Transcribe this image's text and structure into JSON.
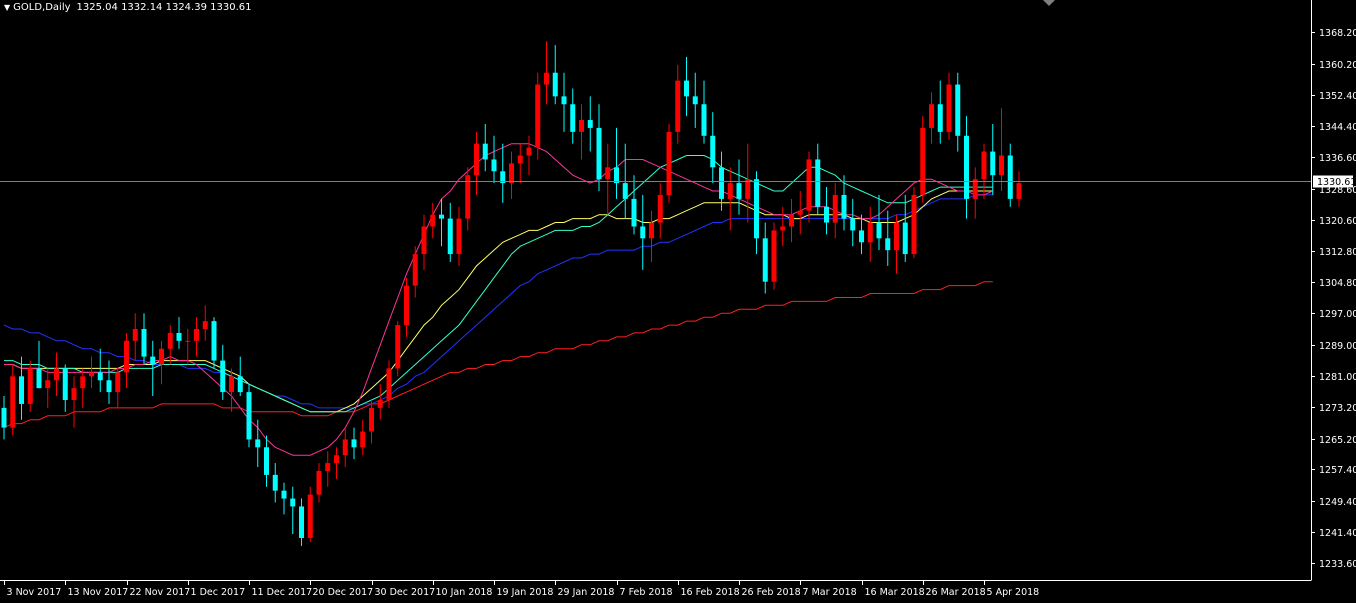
{
  "header": {
    "symbol": "GOLD,Daily",
    "ohlc": "1325.04 1332.14 1324.39 1330.61"
  },
  "colors": {
    "background": "#000000",
    "axis": "#ffffff",
    "bull_candle": "#ff0000",
    "bear_candle": "#00ffff",
    "ma_fast_magenta": "#ff3399",
    "ma_cyan": "#33ffcc",
    "ma_yellow": "#ffff66",
    "ma_blue": "#2233ff",
    "ma_long_red": "#ff2020",
    "price_line": "#4f7fff"
  },
  "chart_data": {
    "type": "candlestick",
    "ylim": [
      1229.6,
      1372.0
    ],
    "price_ticks": [
      1368.2,
      1360.2,
      1352.4,
      1344.4,
      1336.6,
      1328.6,
      1320.6,
      1312.8,
      1304.8,
      1297.0,
      1289.0,
      1281.0,
      1273.2,
      1265.2,
      1257.4,
      1249.4,
      1241.4,
      1233.6
    ],
    "date_labels": [
      "3 Nov 2017",
      "13 Nov 2017",
      "22 Nov 2017",
      "1 Dec 2017",
      "11 Dec 2017",
      "20 Dec 2017",
      "30 Dec 2017",
      "10 Jan 2018",
      "19 Jan 2018",
      "29 Jan 2018",
      "7 Feb 2018",
      "16 Feb 2018",
      "26 Feb 2018",
      "7 Mar 2018",
      "16 Mar 2018",
      "26 Mar 2018",
      "5 Apr 2018"
    ],
    "date_label_index": [
      0,
      7,
      14,
      21,
      28,
      35,
      42,
      49,
      56,
      63,
      70,
      77,
      84,
      91,
      98,
      105,
      112
    ],
    "current_price": 1330.61,
    "current_price_label": "1330.61",
    "candles": [
      [
        1273,
        1276,
        1265,
        1268
      ],
      [
        1268,
        1284,
        1266,
        1281
      ],
      [
        1281,
        1286,
        1270,
        1274
      ],
      [
        1274,
        1285,
        1272,
        1283
      ],
      [
        1283,
        1290,
        1278,
        1278
      ],
      [
        1278,
        1283,
        1273,
        1280
      ],
      [
        1280,
        1287,
        1276,
        1283
      ],
      [
        1283,
        1284,
        1272,
        1275
      ],
      [
        1275,
        1281,
        1268,
        1278
      ],
      [
        1278,
        1283,
        1273,
        1281
      ],
      [
        1281,
        1286,
        1278,
        1282
      ],
      [
        1282,
        1288,
        1277,
        1280
      ],
      [
        1280,
        1285,
        1274,
        1277
      ],
      [
        1277,
        1283,
        1273,
        1282
      ],
      [
        1282,
        1292,
        1278,
        1290
      ],
      [
        1290,
        1297,
        1285,
        1293
      ],
      [
        1293,
        1297,
        1284,
        1286
      ],
      [
        1286,
        1290,
        1276,
        1284
      ],
      [
        1284,
        1290,
        1279,
        1288
      ],
      [
        1288,
        1294,
        1284,
        1292
      ],
      [
        1292,
        1296,
        1288,
        1290
      ],
      [
        1290,
        1293,
        1284,
        1290
      ],
      [
        1290,
        1296,
        1286,
        1293
      ],
      [
        1293,
        1299,
        1290,
        1295
      ],
      [
        1295,
        1296,
        1283,
        1285
      ],
      [
        1285,
        1289,
        1275,
        1277
      ],
      [
        1277,
        1283,
        1272,
        1281
      ],
      [
        1281,
        1286,
        1276,
        1277
      ],
      [
        1277,
        1279,
        1263,
        1265
      ],
      [
        1265,
        1270,
        1258,
        1263
      ],
      [
        1263,
        1266,
        1253,
        1256
      ],
      [
        1256,
        1259,
        1249,
        1252
      ],
      [
        1252,
        1254,
        1246,
        1250
      ],
      [
        1250,
        1253,
        1241,
        1248
      ],
      [
        1248,
        1250,
        1238,
        1240
      ],
      [
        1240,
        1253,
        1239,
        1251
      ],
      [
        1251,
        1259,
        1249,
        1257
      ],
      [
        1257,
        1262,
        1253,
        1259
      ],
      [
        1259,
        1263,
        1255,
        1261
      ],
      [
        1261,
        1268,
        1258,
        1265
      ],
      [
        1265,
        1268,
        1260,
        1263
      ],
      [
        1263,
        1270,
        1261,
        1267
      ],
      [
        1267,
        1275,
        1264,
        1273
      ],
      [
        1273,
        1279,
        1270,
        1275
      ],
      [
        1275,
        1285,
        1273,
        1283
      ],
      [
        1283,
        1295,
        1281,
        1294
      ],
      [
        1294,
        1306,
        1291,
        1304
      ],
      [
        1304,
        1314,
        1301,
        1312
      ],
      [
        1312,
        1322,
        1308,
        1319
      ],
      [
        1319,
        1325,
        1316,
        1322
      ],
      [
        1322,
        1326,
        1314,
        1321
      ],
      [
        1321,
        1325,
        1310,
        1312
      ],
      [
        1312,
        1324,
        1309,
        1321
      ],
      [
        1321,
        1334,
        1318,
        1332
      ],
      [
        1332,
        1343,
        1327,
        1340
      ],
      [
        1340,
        1345,
        1333,
        1336
      ],
      [
        1336,
        1342,
        1330,
        1333
      ],
      [
        1333,
        1340,
        1325,
        1330
      ],
      [
        1330,
        1338,
        1326,
        1335
      ],
      [
        1335,
        1340,
        1330,
        1337
      ],
      [
        1337,
        1342,
        1332,
        1339
      ],
      [
        1339,
        1358,
        1336,
        1355
      ],
      [
        1355,
        1366,
        1350,
        1358
      ],
      [
        1358,
        1365,
        1350,
        1352
      ],
      [
        1352,
        1358,
        1343,
        1350
      ],
      [
        1350,
        1354,
        1340,
        1343
      ],
      [
        1343,
        1350,
        1336,
        1346
      ],
      [
        1346,
        1352,
        1338,
        1344
      ],
      [
        1344,
        1350,
        1328,
        1331
      ],
      [
        1331,
        1340,
        1322,
        1334
      ],
      [
        1334,
        1344,
        1326,
        1330
      ],
      [
        1330,
        1340,
        1321,
        1326
      ],
      [
        1326,
        1332,
        1317,
        1319
      ],
      [
        1319,
        1327,
        1308,
        1316
      ],
      [
        1316,
        1323,
        1310,
        1320
      ],
      [
        1320,
        1330,
        1316,
        1327
      ],
      [
        1327,
        1345,
        1325,
        1343
      ],
      [
        1343,
        1360,
        1340,
        1356
      ],
      [
        1356,
        1362,
        1347,
        1352
      ],
      [
        1352,
        1358,
        1344,
        1350
      ],
      [
        1350,
        1356,
        1340,
        1342
      ],
      [
        1342,
        1348,
        1330,
        1334
      ],
      [
        1334,
        1338,
        1323,
        1326
      ],
      [
        1326,
        1334,
        1318,
        1330
      ],
      [
        1330,
        1336,
        1322,
        1326
      ],
      [
        1326,
        1340,
        1320,
        1331
      ],
      [
        1331,
        1333,
        1312,
        1316
      ],
      [
        1316,
        1320,
        1302,
        1305
      ],
      [
        1305,
        1320,
        1303,
        1318
      ],
      [
        1318,
        1324,
        1314,
        1319
      ],
      [
        1319,
        1326,
        1315,
        1322
      ],
      [
        1322,
        1328,
        1317,
        1323
      ],
      [
        1323,
        1338,
        1320,
        1336
      ],
      [
        1336,
        1340,
        1322,
        1324
      ],
      [
        1324,
        1329,
        1317,
        1320
      ],
      [
        1320,
        1330,
        1316,
        1327
      ],
      [
        1327,
        1332,
        1318,
        1321
      ],
      [
        1321,
        1326,
        1314,
        1318
      ],
      [
        1318,
        1322,
        1312,
        1315
      ],
      [
        1315,
        1324,
        1310,
        1320
      ],
      [
        1320,
        1327,
        1313,
        1316
      ],
      [
        1316,
        1323,
        1309,
        1313
      ],
      [
        1313,
        1322,
        1307,
        1320
      ],
      [
        1320,
        1327,
        1310,
        1312
      ],
      [
        1312,
        1329,
        1311,
        1327
      ],
      [
        1327,
        1347,
        1325,
        1344
      ],
      [
        1344,
        1353,
        1340,
        1350
      ],
      [
        1350,
        1356,
        1340,
        1343
      ],
      [
        1343,
        1358,
        1341,
        1355
      ],
      [
        1355,
        1358,
        1338,
        1342
      ],
      [
        1342,
        1347,
        1321,
        1326
      ],
      [
        1326,
        1334,
        1321,
        1331
      ],
      [
        1331,
        1340,
        1326,
        1338
      ],
      [
        1338,
        1345,
        1327,
        1332
      ],
      [
        1332,
        1349,
        1328,
        1337
      ],
      [
        1337,
        1340,
        1324,
        1326
      ],
      [
        1326,
        1333,
        1324,
        1330
      ]
    ],
    "moving_averages": [
      {
        "role": "ma_long_red",
        "values": [
          1268,
          1269,
          1269,
          1270,
          1270,
          1271,
          1271,
          1271,
          1272,
          1272,
          1272,
          1272,
          1273,
          1273,
          1273,
          1273,
          1273,
          1273,
          1274,
          1274,
          1274,
          1274,
          1274,
          1274,
          1274,
          1273,
          1273,
          1273,
          1272,
          1272,
          1272,
          1272,
          1272,
          1272,
          1271,
          1271,
          1271,
          1271,
          1272,
          1272,
          1272,
          1273,
          1274,
          1274,
          1275,
          1276,
          1277,
          1278,
          1279,
          1280,
          1281,
          1282,
          1282,
          1283,
          1283,
          1284,
          1284,
          1285,
          1285,
          1286,
          1286,
          1287,
          1287,
          1288,
          1288,
          1288,
          1289,
          1289,
          1290,
          1290,
          1291,
          1291,
          1292,
          1292,
          1293,
          1293,
          1294,
          1294,
          1295,
          1295,
          1296,
          1296,
          1297,
          1297,
          1298,
          1298,
          1298,
          1299,
          1299,
          1299,
          1300,
          1300,
          1300,
          1300,
          1300,
          1301,
          1301,
          1301,
          1301,
          1302,
          1302,
          1302,
          1302,
          1302,
          1302,
          1303,
          1303,
          1303,
          1304,
          1304,
          1304,
          1304,
          1305,
          1305
        ]
      },
      {
        "role": "ma_blue",
        "values": [
          1294,
          1293,
          1293,
          1292,
          1292,
          1291,
          1290,
          1290,
          1289,
          1288,
          1288,
          1287,
          1287,
          1286,
          1286,
          1285,
          1285,
          1284,
          1284,
          1284,
          1284,
          1283,
          1283,
          1283,
          1282,
          1282,
          1281,
          1280,
          1279,
          1278,
          1277,
          1276,
          1276,
          1275,
          1274,
          1274,
          1273,
          1273,
          1273,
          1273,
          1273,
          1274,
          1274,
          1275,
          1276,
          1278,
          1279,
          1281,
          1282,
          1284,
          1286,
          1288,
          1290,
          1292,
          1294,
          1296,
          1298,
          1300,
          1302,
          1304,
          1305,
          1307,
          1308,
          1309,
          1310,
          1311,
          1311,
          1312,
          1312,
          1313,
          1313,
          1313,
          1313,
          1314,
          1314,
          1315,
          1315,
          1316,
          1317,
          1318,
          1319,
          1320,
          1320,
          1321,
          1321,
          1321,
          1321,
          1321,
          1321,
          1321,
          1321,
          1321,
          1321,
          1321,
          1321,
          1321,
          1321,
          1321,
          1321,
          1321,
          1321,
          1321,
          1322,
          1322,
          1323,
          1324,
          1325,
          1326,
          1326,
          1326,
          1326,
          1327,
          1327,
          1327
        ]
      },
      {
        "role": "ma_yellow",
        "values": [
          1284,
          1284,
          1283,
          1283,
          1283,
          1283,
          1283,
          1283,
          1283,
          1283,
          1283,
          1283,
          1283,
          1283,
          1284,
          1284,
          1284,
          1284,
          1285,
          1285,
          1285,
          1285,
          1285,
          1285,
          1284,
          1283,
          1282,
          1281,
          1279,
          1278,
          1277,
          1276,
          1275,
          1274,
          1273,
          1272,
          1272,
          1272,
          1272,
          1273,
          1274,
          1276,
          1278,
          1280,
          1282,
          1285,
          1288,
          1291,
          1294,
          1296,
          1299,
          1301,
          1303,
          1306,
          1309,
          1311,
          1313,
          1315,
          1316,
          1317,
          1318,
          1318,
          1319,
          1320,
          1320,
          1321,
          1321,
          1321,
          1322,
          1322,
          1321,
          1321,
          1321,
          1320,
          1320,
          1321,
          1321,
          1322,
          1323,
          1324,
          1325,
          1325,
          1325,
          1325,
          1325,
          1324,
          1323,
          1322,
          1322,
          1322,
          1321,
          1321,
          1322,
          1322,
          1322,
          1322,
          1322,
          1321,
          1321,
          1320,
          1320,
          1320,
          1320,
          1321,
          1322,
          1324,
          1326,
          1327,
          1328,
          1328,
          1328,
          1328,
          1328,
          1328
        ]
      },
      {
        "role": "ma_cyan",
        "values": [
          1285,
          1285,
          1284,
          1284,
          1284,
          1283,
          1283,
          1283,
          1283,
          1282,
          1282,
          1282,
          1282,
          1282,
          1283,
          1283,
          1283,
          1283,
          1284,
          1284,
          1284,
          1284,
          1284,
          1284,
          1283,
          1282,
          1281,
          1280,
          1279,
          1278,
          1277,
          1276,
          1275,
          1274,
          1273,
          1272,
          1272,
          1272,
          1272,
          1272,
          1273,
          1274,
          1275,
          1276,
          1278,
          1280,
          1282,
          1284,
          1286,
          1288,
          1290,
          1292,
          1294,
          1297,
          1300,
          1303,
          1306,
          1309,
          1312,
          1314,
          1315,
          1316,
          1317,
          1318,
          1318,
          1318,
          1319,
          1319,
          1320,
          1322,
          1324,
          1326,
          1328,
          1330,
          1332,
          1334,
          1335,
          1336,
          1337,
          1337,
          1337,
          1336,
          1334,
          1333,
          1332,
          1331,
          1330,
          1329,
          1328,
          1328,
          1330,
          1332,
          1334,
          1334,
          1333,
          1332,
          1330,
          1329,
          1328,
          1327,
          1326,
          1325,
          1325,
          1325,
          1326,
          1327,
          1328,
          1329,
          1329,
          1329,
          1329,
          1329,
          1329,
          1329
        ]
      },
      {
        "role": "ma_fast_magenta",
        "values": [
          1284,
          1284,
          1283,
          1283,
          1283,
          1282,
          1282,
          1282,
          1282,
          1282,
          1282,
          1282,
          1282,
          1283,
          1283,
          1284,
          1284,
          1285,
          1285,
          1286,
          1285,
          1285,
          1284,
          1282,
          1280,
          1278,
          1276,
          1273,
          1270,
          1268,
          1265,
          1263,
          1262,
          1261,
          1261,
          1261,
          1262,
          1263,
          1265,
          1268,
          1272,
          1277,
          1283,
          1289,
          1295,
          1301,
          1307,
          1312,
          1317,
          1322,
          1326,
          1328,
          1331,
          1333,
          1335,
          1337,
          1338,
          1339,
          1340,
          1340,
          1340,
          1339,
          1338,
          1336,
          1334,
          1332,
          1331,
          1330,
          1331,
          1333,
          1334,
          1336,
          1336,
          1336,
          1335,
          1334,
          1333,
          1332,
          1331,
          1330,
          1329,
          1328,
          1328,
          1327,
          1326,
          1325,
          1324,
          1323,
          1322,
          1322,
          1322,
          1323,
          1324,
          1324,
          1324,
          1323,
          1322,
          1322,
          1321,
          1321,
          1322,
          1324,
          1326,
          1328,
          1330,
          1331,
          1331,
          1330,
          1329,
          1328,
          1328,
          1327,
          1327,
          1328
        ]
      }
    ]
  }
}
